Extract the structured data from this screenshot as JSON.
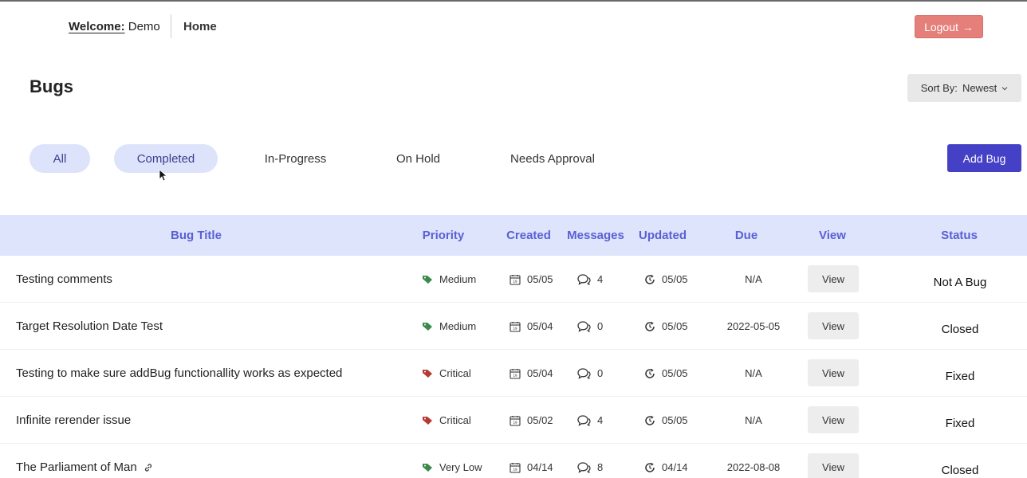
{
  "header": {
    "welcome_label": "Welcome:",
    "user_name": "Demo",
    "home_label": "Home",
    "logout_label": "Logout",
    "logout_arrow": "→"
  },
  "page": {
    "title": "Bugs",
    "sort_label": "Sort By:",
    "sort_value": "Newest",
    "add_bug_label": "Add Bug"
  },
  "filters": [
    {
      "label": "All",
      "active": true
    },
    {
      "label": "Completed",
      "active": true
    },
    {
      "label": "In-Progress",
      "active": false
    },
    {
      "label": "On Hold",
      "active": false
    },
    {
      "label": "Needs Approval",
      "active": false
    }
  ],
  "table": {
    "columns": [
      "Bug Title",
      "Priority",
      "Created",
      "Messages",
      "Updated",
      "Due",
      "View",
      "Status"
    ],
    "rows": [
      {
        "title": "Testing comments",
        "priority": "Medium",
        "priority_color": "#3c8a4a",
        "created": "05/05",
        "messages": "4",
        "updated": "05/05",
        "due": "N/A",
        "view": "View",
        "status": "Not A Bug",
        "has_link": false
      },
      {
        "title": "Target Resolution Date Test",
        "priority": "Medium",
        "priority_color": "#3c8a4a",
        "created": "05/04",
        "messages": "0",
        "updated": "05/05",
        "due": "2022-05-05",
        "view": "View",
        "status": "Closed",
        "has_link": false
      },
      {
        "title": "Testing to make sure addBug functionallity works as expected",
        "priority": "Critical",
        "priority_color": "#b53a35",
        "created": "05/04",
        "messages": "0",
        "updated": "05/05",
        "due": "N/A",
        "view": "View",
        "status": "Fixed",
        "has_link": false
      },
      {
        "title": "Infinite rerender issue",
        "priority": "Critical",
        "priority_color": "#b53a35",
        "created": "05/02",
        "messages": "4",
        "updated": "05/05",
        "due": "N/A",
        "view": "View",
        "status": "Fixed",
        "has_link": false
      },
      {
        "title": "The Parliament of Man",
        "priority": "Very Low",
        "priority_color": "#3c8a4a",
        "created": "04/14",
        "messages": "8",
        "updated": "04/14",
        "due": "2022-08-08",
        "view": "View",
        "status": "Closed",
        "has_link": true
      }
    ]
  },
  "colors": {
    "accent": "#4541c6",
    "header_bg": "#dde4fb",
    "header_text": "#5a5fd6",
    "logout_bg": "#e57f7a",
    "tab_active_bg": "#dde3fb"
  },
  "icons": {
    "priority": "tag-icon",
    "created": "calendar-icon",
    "messages": "chat-bubbles-icon",
    "updated": "refresh-clock-icon",
    "link": "link-icon",
    "logout": "arrow-right-icon",
    "sort": "chevron-down-icon"
  }
}
